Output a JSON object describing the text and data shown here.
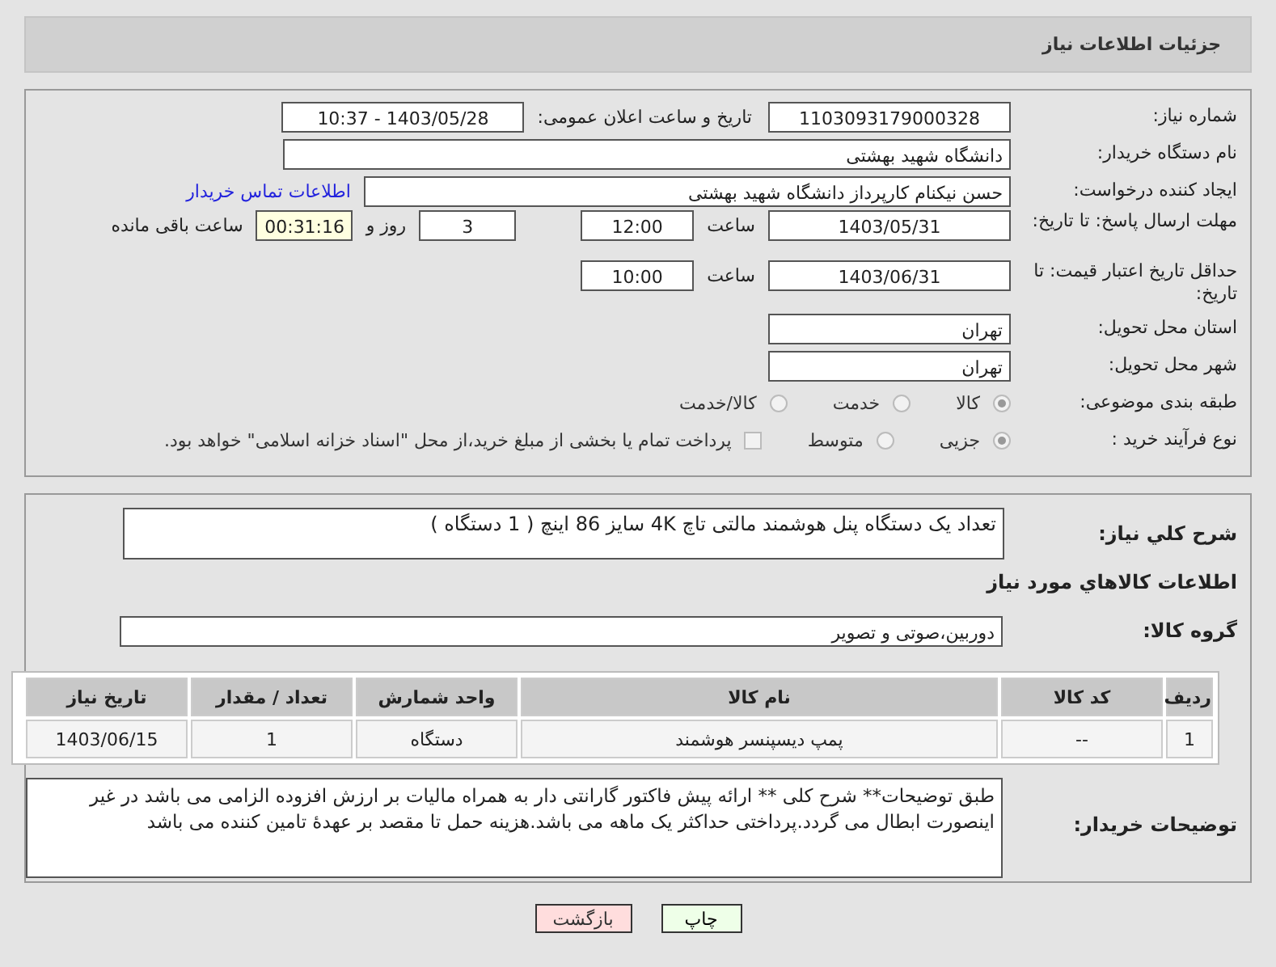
{
  "header": {
    "title": "جزئیات اطلاعات نیاز"
  },
  "need_number": {
    "label": "شماره نیاز:",
    "value": "1103093179000328"
  },
  "announce": {
    "label": "تاریخ و ساعت اعلان عمومی:",
    "value": "1403/05/28 - 10:37"
  },
  "buyer_org": {
    "label": "نام دستگاه خریدار:",
    "value": "دانشگاه شهید بهشتی"
  },
  "requester": {
    "label": "ایجاد کننده درخواست:",
    "value": "حسن نیکنام کارپرداز دانشگاه شهید بهشتی",
    "link": "اطلاعات تماس خریدار"
  },
  "response_deadline": {
    "label": "مهلت ارسال پاسخ: تا تاریخ:",
    "date": "1403/05/31",
    "time_label": "ساعت",
    "time": "12:00",
    "days": "3",
    "days_label": "روز و",
    "remaining": "00:31:16",
    "remaining_label": "ساعت باقی مانده"
  },
  "price_validity": {
    "label": "حداقل تاریخ اعتبار قیمت: تا تاریخ:",
    "date": "1403/06/31",
    "time_label": "ساعت",
    "time": "10:00"
  },
  "province": {
    "label": "استان محل تحویل:",
    "value": "تهران"
  },
  "city": {
    "label": "شهر محل تحویل:",
    "value": "تهران"
  },
  "category": {
    "label": "طبقه بندی موضوعی:",
    "options": [
      {
        "label": "کالا",
        "selected": true
      },
      {
        "label": "خدمت",
        "selected": false
      },
      {
        "label": "کالا/خدمت",
        "selected": false
      }
    ]
  },
  "purchase_process": {
    "label": "نوع فرآیند خرید :",
    "options": [
      {
        "label": "جزیی",
        "selected": true
      },
      {
        "label": "متوسط",
        "selected": false
      }
    ],
    "payment_checkbox": {
      "label": "پرداخت تمام یا بخشی از مبلغ خرید،از محل \"اسناد خزانه اسلامی\" خواهد بود.",
      "checked": false
    }
  },
  "description": {
    "label": "شرح کلي نياز:",
    "value": "تعداد یک دستگاه پنل هوشمند مالتی تاچ 4K سایز 86 اینچ  ( 1 دستگاه )"
  },
  "items_section": {
    "title": "اطلاعات کالاهاي مورد نياز"
  },
  "goods_group": {
    "label": "گروه کالا:",
    "value": "دوربین،صوتی و تصویر"
  },
  "table": {
    "columns": [
      "ردیف",
      "کد کالا",
      "نام کالا",
      "واحد شمارش",
      "تعداد / مقدار",
      "تاریخ نیاز"
    ],
    "rows": [
      [
        "1",
        "--",
        "پمپ دیسپنسر هوشمند",
        "دستگاه",
        "1",
        "1403/06/15"
      ]
    ]
  },
  "buyer_notes": {
    "label": "توضیحات خریدار:",
    "value": "طبق توضیحات** شرح کلی   ** ارائه پیش فاکتور  گارانتی دار به همراه مالیات بر ارزش افزوده الزامی می باشد در غیر اینصورت ابطال می گردد.پرداختی حداکثر یک ماهه می باشد.هزینه حمل تا مقصد بر عهدهٔ تامین کننده می باشد"
  },
  "buttons": [
    {
      "label": "چاپ",
      "kind": "print"
    },
    {
      "label": "بازگشت",
      "kind": "back"
    }
  ]
}
